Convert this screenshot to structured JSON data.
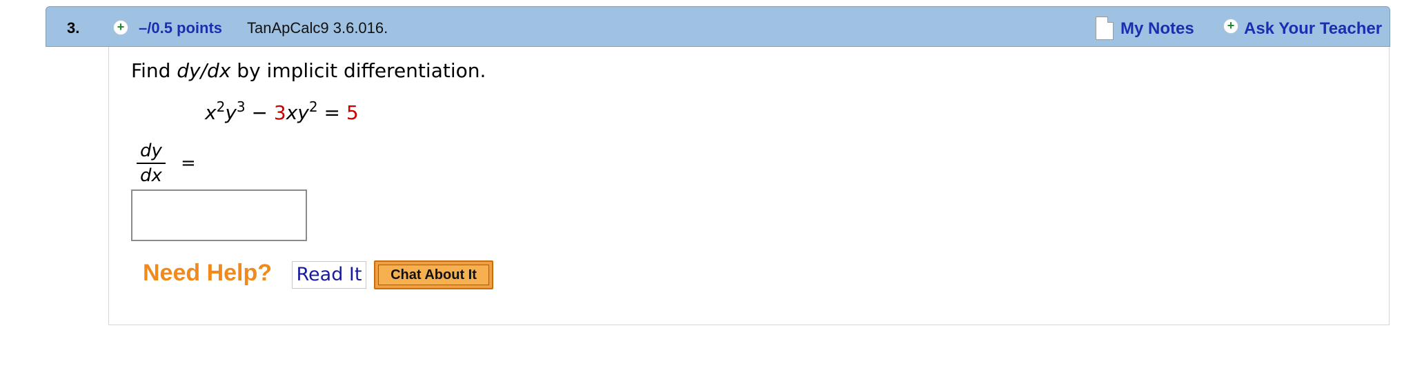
{
  "question": {
    "number": "3.",
    "points": "–/0.5 points",
    "id": "TanApCalc9 3.6.016.",
    "my_notes": "My Notes",
    "ask_teacher": "Ask Your Teacher"
  },
  "prompt": {
    "find": "Find ",
    "dydx": "dy/dx",
    "rest": " by implicit differentiation."
  },
  "equation": {
    "x": "x",
    "exp1": "2",
    "y1": "y",
    "exp2": "3",
    "minus": " − ",
    "coef": "3",
    "xy": "xy",
    "exp3": "2",
    "equals": " = ",
    "rhs": "5"
  },
  "answer": {
    "numerator": "dy",
    "denominator": "dx",
    "equals": "=",
    "value": ""
  },
  "help": {
    "label": "Need Help?",
    "read_it": "Read It",
    "chat": "Chat About It"
  },
  "colors": {
    "header_bg": "#9fc2e2",
    "link": "#1a2fb0",
    "given_number": "#cc0000",
    "need_help": "#f08a1c",
    "chat_button": "#f0a042"
  }
}
